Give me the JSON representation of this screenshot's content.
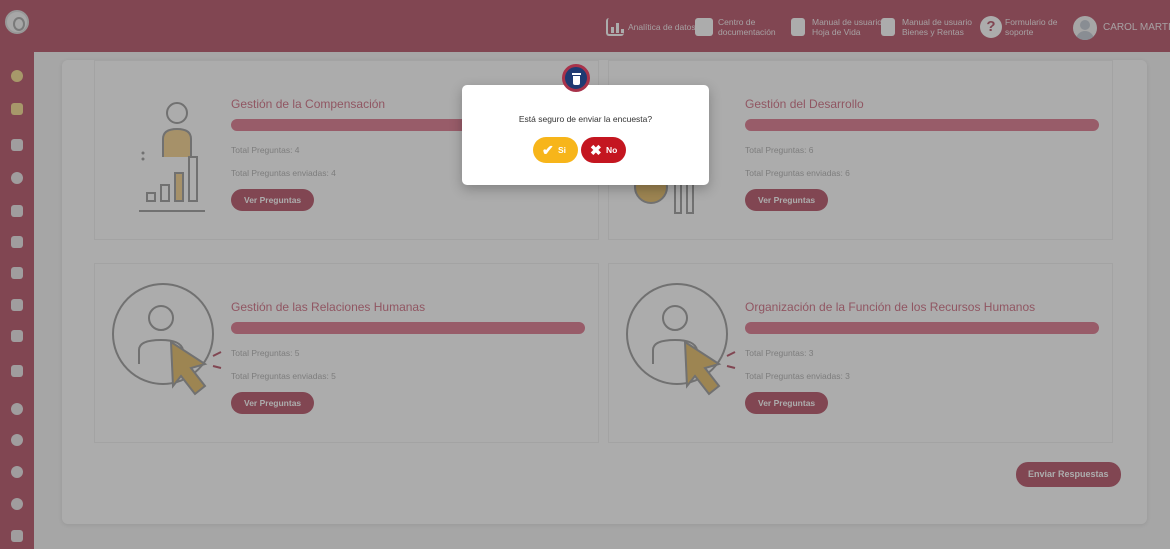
{
  "topbar": {
    "items": [
      {
        "icon": "chart-icon",
        "label": "Analítica de datos"
      },
      {
        "icon": "document-icon",
        "label1": "Centro de",
        "label2": "documentación"
      },
      {
        "icon": "manual-icon",
        "label1": "Manual de usuario",
        "label2": "Hoja de Vida"
      },
      {
        "icon": "manual-money-icon",
        "label1": "Manual de usuario",
        "label2": "Bienes y Rentas"
      },
      {
        "icon": "help-icon",
        "label1": "Formulario de",
        "label2": "soporte"
      }
    ],
    "help_glyph": "?",
    "user": "CAROL MARTIN"
  },
  "sidebar": {
    "items": [
      "gear-icon",
      "calendar-icon",
      "calendar-icon",
      "gear-icon",
      "document-icon",
      "calendar-icon",
      "calendar-icon",
      "calendar-icon",
      "calendar-icon",
      "calendar-icon",
      "circle-icon",
      "circle-icon",
      "circle-icon",
      "circle-icon",
      "calendar-icon"
    ]
  },
  "cards": [
    {
      "title": "Gestión de la Compensación",
      "preguntas": "Total Preguntas: 4",
      "enviadas": "Total Preguntas enviadas: 4",
      "button": "Ver Preguntas",
      "progress": 1.0,
      "icon": "growth-chart-person-icon"
    },
    {
      "title": "Gestión del Desarrollo",
      "preguntas": "Total Preguntas: 6",
      "enviadas": "Total Preguntas enviadas: 6",
      "button": "Ver Preguntas",
      "progress": 1.0,
      "icon": "growth-gear-icon"
    },
    {
      "title": "Gestión de las Relaciones Humanas",
      "preguntas": "Total Preguntas: 5",
      "enviadas": "Total Preguntas enviadas: 5",
      "button": "Ver Preguntas",
      "progress": 1.0,
      "icon": "user-cursor-icon"
    },
    {
      "title": "Organización de la Función de los Recursos Humanos",
      "preguntas": "Total Preguntas: 3",
      "enviadas": "Total Preguntas enviadas: 3",
      "button": "Ver Preguntas",
      "progress": 1.0,
      "icon": "user-cursor-icon"
    }
  ],
  "send_button": "Enviar Respuestas",
  "modal": {
    "icon": "trash-icon",
    "message": "Está seguro de enviar la encuesta?",
    "yes": "Si",
    "yes_icon": "✔",
    "no": "No",
    "no_icon": "✖"
  },
  "colors": {
    "brand": "#a8324a",
    "progress": "#d65f79",
    "yes": "#f7b51a",
    "no": "#c41620",
    "accent": "#e0b04a"
  }
}
